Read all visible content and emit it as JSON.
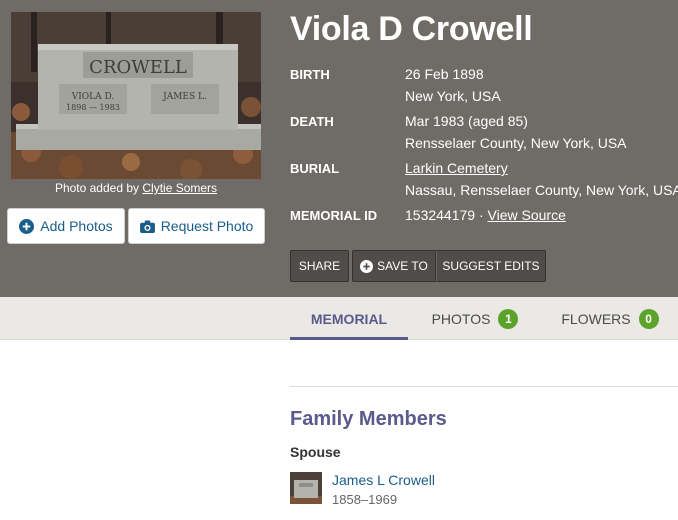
{
  "memorial": {
    "name": "Viola D Crowell",
    "photo_credit_prefix": "Photo added by",
    "photo_credit_user": "Clytie Somers",
    "headstone_text": {
      "surname": "CROWELL",
      "left_name": "VIOLA D.",
      "left_years": "1898 — 1983",
      "right_name": "JAMES L."
    }
  },
  "buttons": {
    "add_photos": "Add Photos",
    "request_photo": "Request Photo"
  },
  "fields": {
    "birth_label": "BIRTH",
    "birth_date": "26 Feb 1898",
    "birth_place": "New York, USA",
    "death_label": "DEATH",
    "death_date": "Mar 1983 (aged 85)",
    "death_place": "Rensselaer County, New York, USA",
    "burial_label": "BURIAL",
    "burial_cemetery": "Larkin Cemetery",
    "burial_place": "Nassau, Rensselaer County, New York, USA",
    "memorial_id_label": "MEMORIAL ID",
    "memorial_id": "153244179",
    "id_separator": " · ",
    "view_source": "View Source"
  },
  "actions": {
    "share": "SHARE",
    "save_to": "SAVE TO",
    "suggest_edits": "SUGGEST EDITS"
  },
  "tabs": [
    {
      "label": "MEMORIAL",
      "active": true
    },
    {
      "label": "PHOTOS",
      "count": "1"
    },
    {
      "label": "FLOWERS",
      "count": "0"
    }
  ],
  "family": {
    "heading": "Family Members",
    "spouse_label": "Spouse",
    "spouse": {
      "name": "James L Crowell",
      "dates": "1858–1969"
    }
  },
  "colors": {
    "hero_bg": "#6f6b66",
    "link_blue": "#1a5d8a",
    "accent_purple": "#5a5a8c",
    "badge_green": "#5ba32b"
  }
}
